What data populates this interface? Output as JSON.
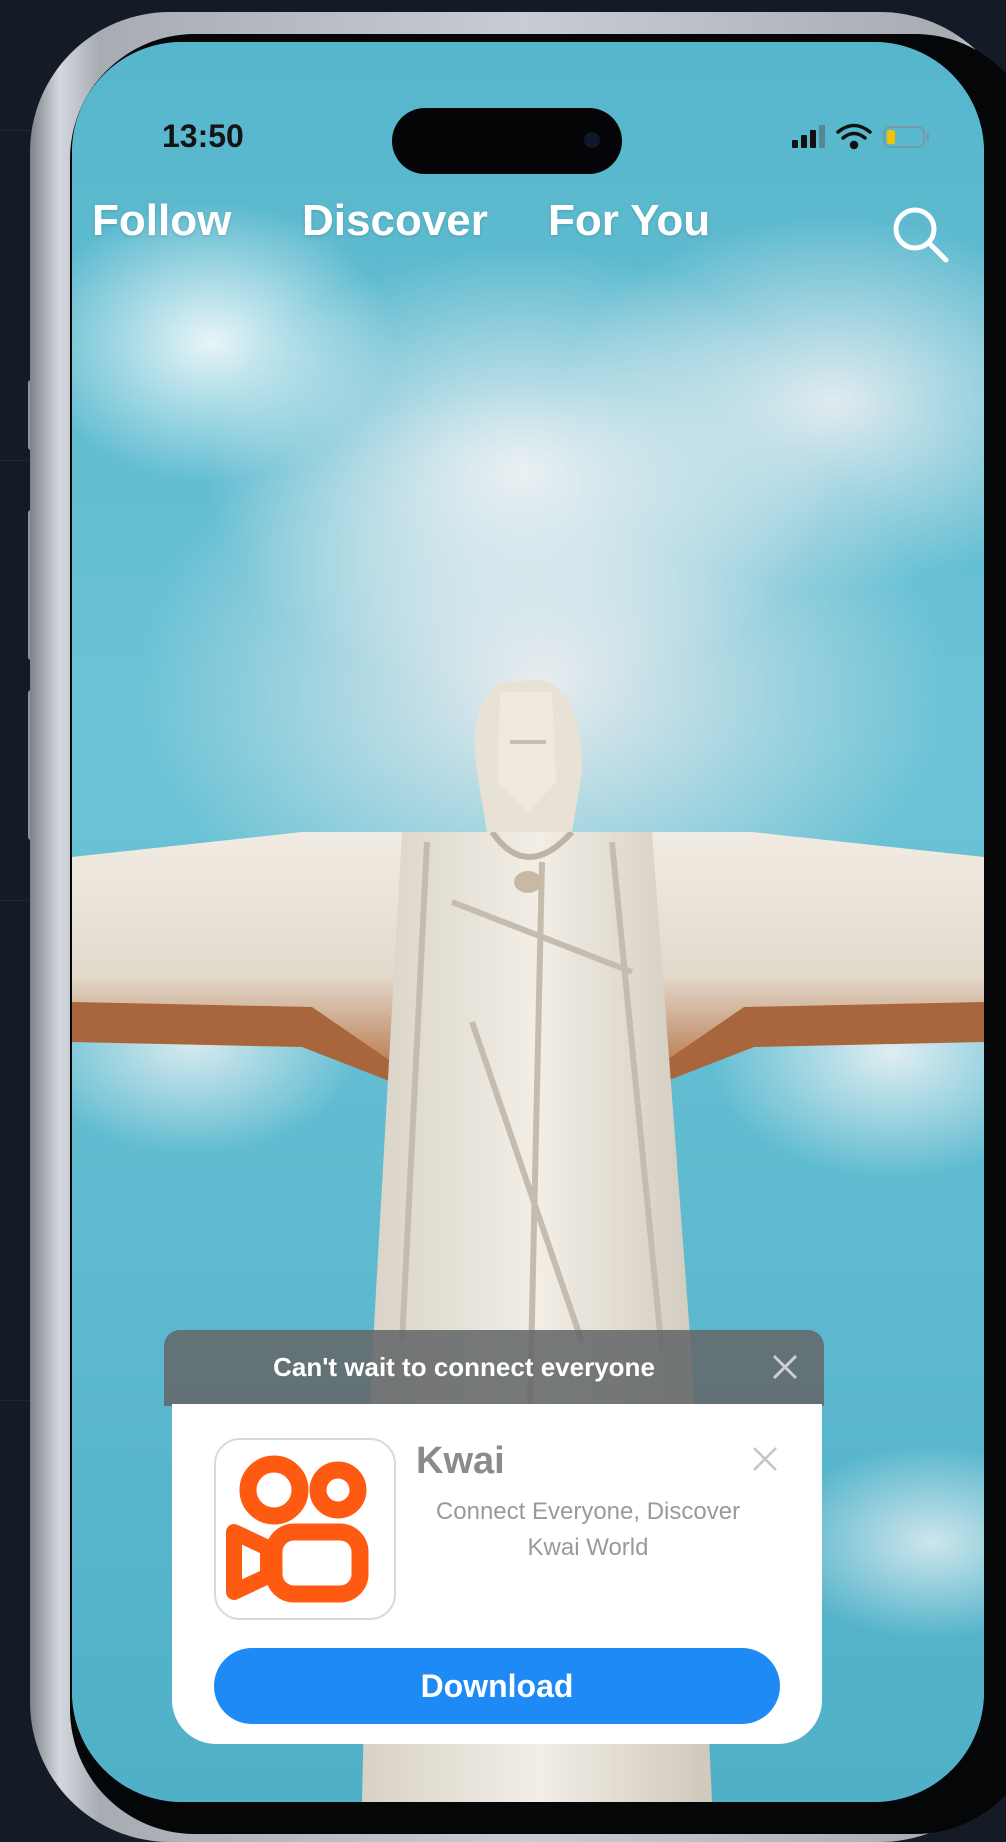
{
  "status_bar": {
    "time": "13:50",
    "icons": [
      "signal-icon",
      "wifi-icon",
      "battery-icon"
    ]
  },
  "top_nav": {
    "tabs": [
      {
        "label": "Follow"
      },
      {
        "label": "Discover"
      },
      {
        "label": "For You"
      }
    ],
    "search_icon": "search-icon"
  },
  "ad": {
    "banner_text": "Can't wait to connect everyone",
    "app_name": "Kwai",
    "app_description": "Connect Everyone, Discover Kwai World",
    "download_label": "Download",
    "colors": {
      "brand": "#ff5a12",
      "button": "#1e8af5"
    }
  }
}
